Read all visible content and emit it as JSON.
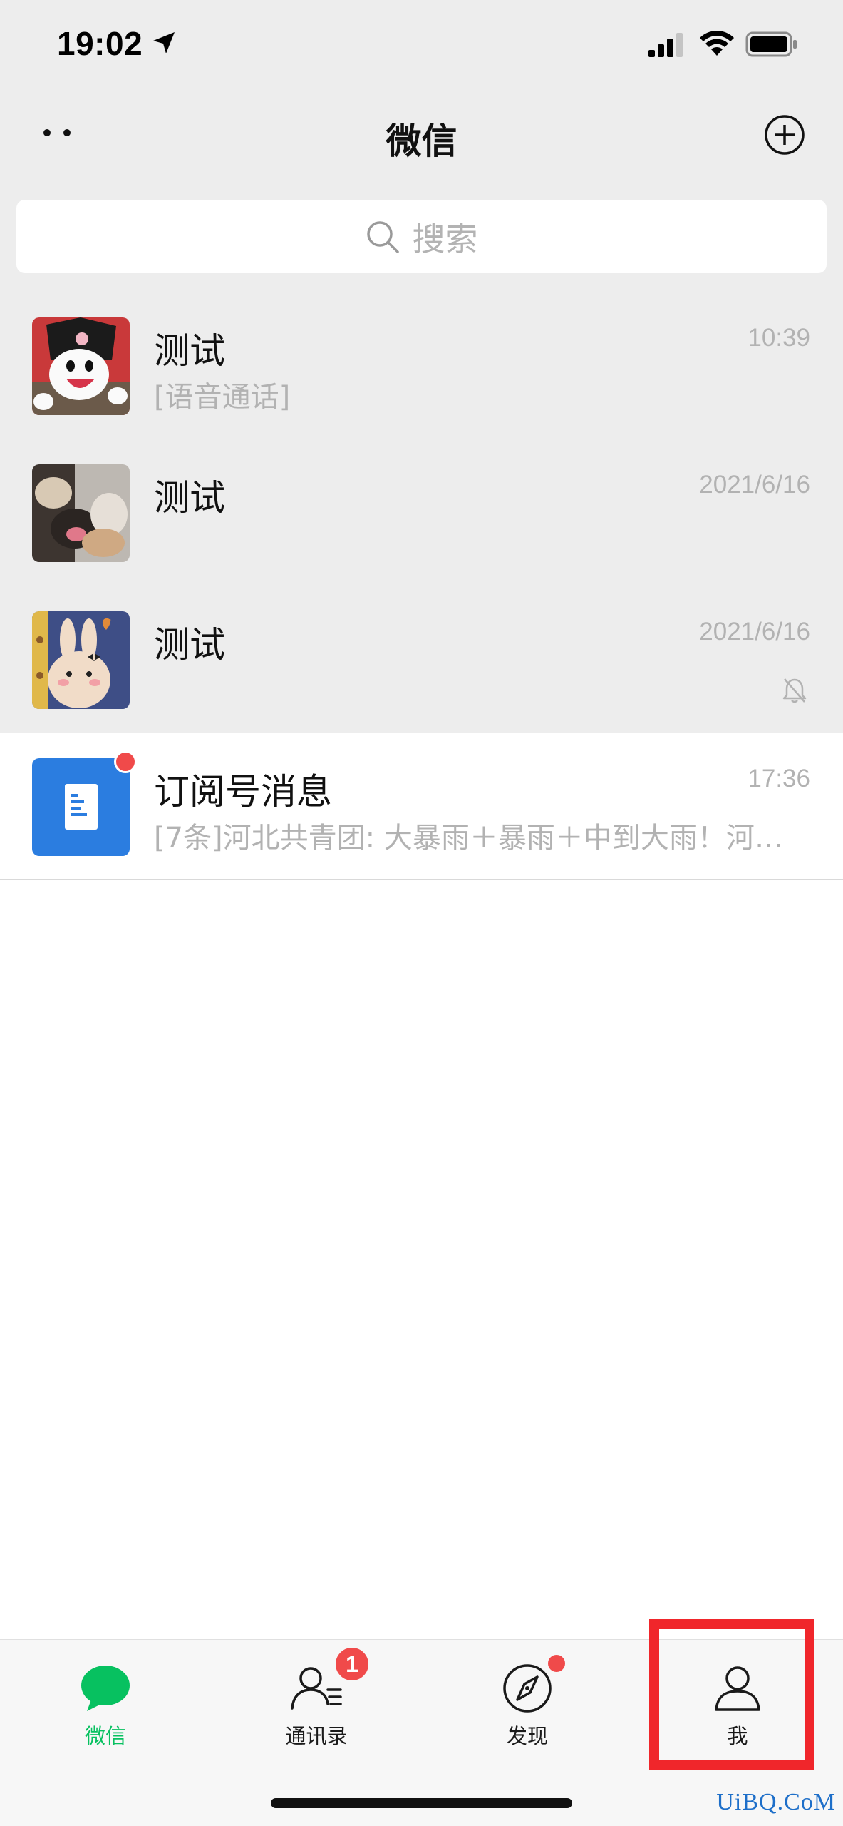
{
  "status_bar": {
    "time": "19:02",
    "icons": [
      "location-arrow-icon",
      "cellular-signal-icon",
      "wifi-icon",
      "battery-icon"
    ]
  },
  "nav": {
    "title": "微信",
    "left_icon": "more-dots-icon",
    "right_icon": "add-circle-icon"
  },
  "search": {
    "placeholder": "搜索"
  },
  "chats": [
    {
      "name": "测试",
      "time": "10:39",
      "preview": "[语音通话]",
      "pinned": true,
      "muted": false,
      "unread_dot": false
    },
    {
      "name": "测试",
      "time": "2021/6/16",
      "preview": "",
      "pinned": true,
      "muted": false,
      "unread_dot": false
    },
    {
      "name": "测试",
      "time": "2021/6/16",
      "preview": "",
      "pinned": true,
      "muted": true,
      "unread_dot": false
    },
    {
      "name": "订阅号消息",
      "time": "17:36",
      "preview": "[7条]河北共青团: 大暴雨＋暴雨＋中到大雨！河…",
      "pinned": false,
      "muted": false,
      "unread_dot": true
    }
  ],
  "tabs": [
    {
      "label": "微信",
      "icon": "chat-bubble-icon",
      "active": true
    },
    {
      "label": "通讯录",
      "icon": "contacts-icon",
      "badge": "1"
    },
    {
      "label": "发现",
      "icon": "compass-icon",
      "dot": true
    },
    {
      "label": "我",
      "icon": "person-icon",
      "highlighted": true
    }
  ],
  "colors": {
    "accent": "#07c160",
    "badge": "#f04a4a",
    "highlight": "#f0262b",
    "header_bg": "#ededed"
  },
  "watermark": "UiBQ.CoM"
}
